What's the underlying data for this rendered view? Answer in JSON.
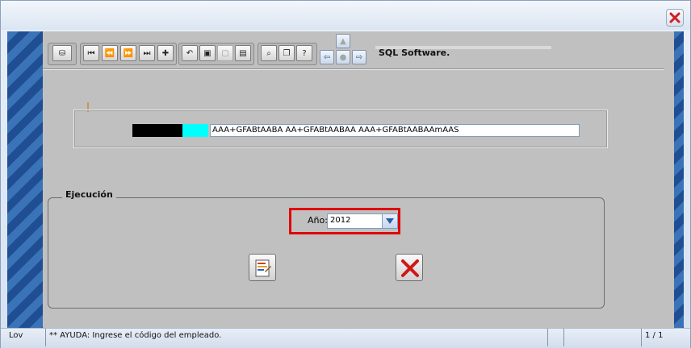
{
  "window": {
    "close_icon": "close-icon"
  },
  "toolbar": {
    "app_name": "SQL Software.",
    "icons": [
      "database-icon",
      "first-record-icon",
      "previous-record-icon",
      "next-record-icon",
      "last-record-icon",
      "new-record-icon",
      "undo-icon",
      "save-icon",
      "delete-icon",
      "report-icon",
      "query-icon",
      "copy-icon",
      "help-icon"
    ]
  },
  "navigation": {
    "up_icon": "arrow-up-icon",
    "left_icon": "arrow-left-icon",
    "center_icon": "center-icon",
    "right_icon": "arrow-right-icon",
    "down_icon": "arrow-down-icon"
  },
  "employee": {
    "name": "AAA+GFABtAABA AA+GFABtAABAA AAA+GFABtAABAAmAAS",
    "code_color": "#000000",
    "indicator_color": "#00ffff"
  },
  "execution": {
    "legend": "Ejecución",
    "year_label": "Año:",
    "year_value": "2012",
    "highlight_color": "#e00000"
  },
  "status": {
    "mode": "Lov",
    "help_text": "** AYUDA: Ingrese el código del empleado.",
    "record": "1 / 1"
  }
}
